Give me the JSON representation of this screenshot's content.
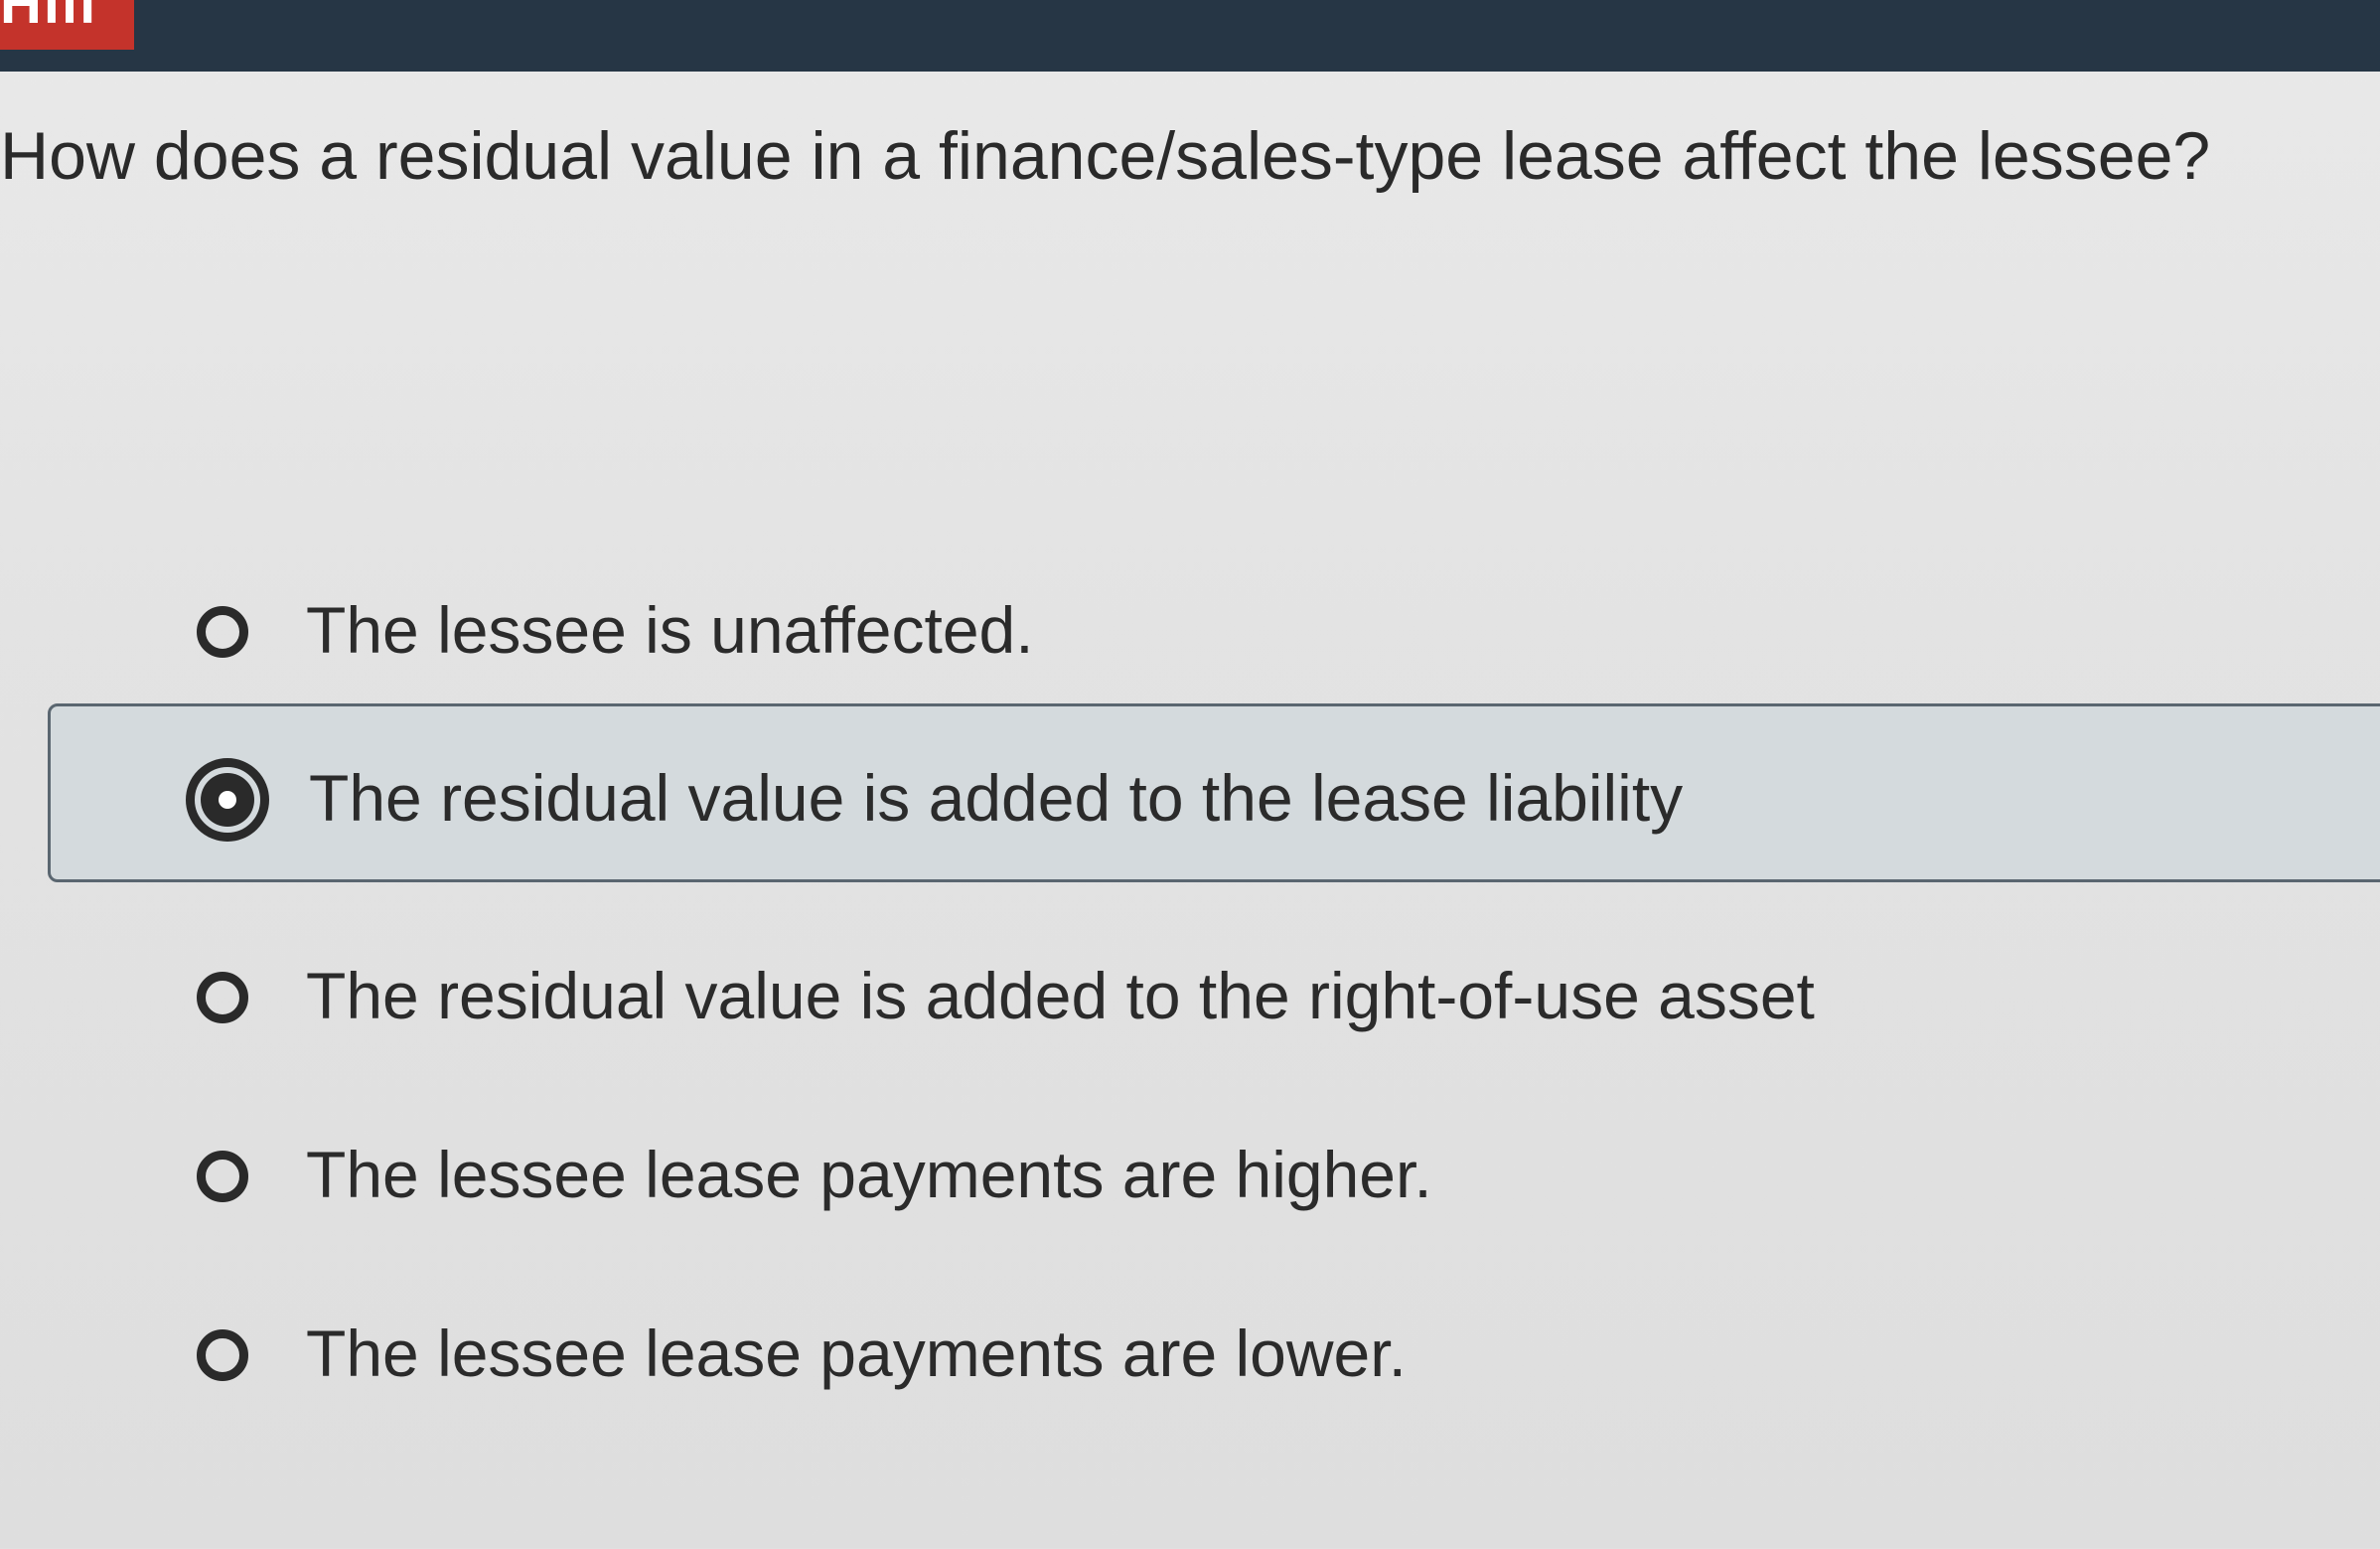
{
  "header": {
    "brand_text": "Hill"
  },
  "question": {
    "text": "How does a residual value in a finance/sales-type lease affect the lessee?"
  },
  "options": [
    {
      "label": "The lessee is unaffected.",
      "selected": false
    },
    {
      "label": "The residual value is added to the lease liability",
      "selected": true
    },
    {
      "label": "The residual value is added to the right-of-use asset",
      "selected": false
    },
    {
      "label": "The lessee lease payments are higher.",
      "selected": false
    },
    {
      "label": "The lessee lease payments are lower.",
      "selected": false
    }
  ],
  "colors": {
    "topbar": "#263645",
    "brand": "#c4332b",
    "selected_background": "#d4dadd"
  }
}
